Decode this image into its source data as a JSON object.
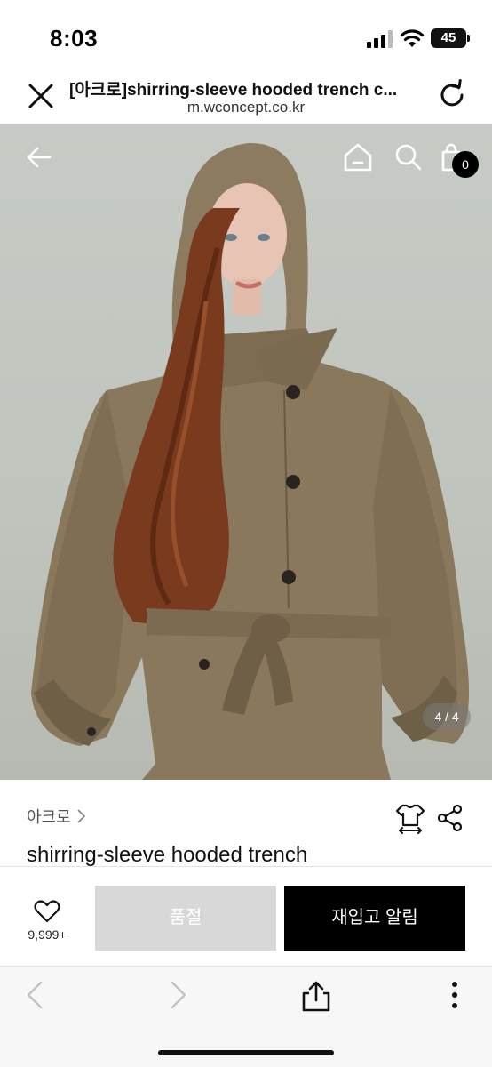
{
  "status_bar": {
    "time": "8:03",
    "battery": "45",
    "icons": [
      "signal-icon",
      "wifi-icon",
      "battery-icon"
    ]
  },
  "browser": {
    "title": "[아크로]shirring-sleeve hooded trench c...",
    "domain": "m.wconcept.co.kr",
    "icons": [
      "close-icon",
      "reload-icon"
    ]
  },
  "hero": {
    "icons": [
      "back-arrow-icon",
      "home-icon",
      "search-icon",
      "shopping-bag-icon"
    ],
    "bag_count": "0",
    "page_indicator": "4 / 4"
  },
  "product": {
    "brand": "아크로",
    "name": "shirring-sleeve hooded trench",
    "icons": [
      "size-guide-icon",
      "share-icon"
    ]
  },
  "purchase_bar": {
    "wish_count": "9,999+",
    "soldout_label": "품절",
    "restock_label": "재입고 알림",
    "icons": [
      "heart-icon"
    ]
  },
  "toolbar": {
    "icons": [
      "back-icon",
      "forward-icon",
      "share-icon",
      "more-icon"
    ]
  },
  "colors": {
    "coat": "#8b7a5f",
    "hair": "#7a3a1e",
    "background": "#c3c8c1",
    "primary_button": "#000000",
    "disabled_button": "#d8d8d8"
  }
}
